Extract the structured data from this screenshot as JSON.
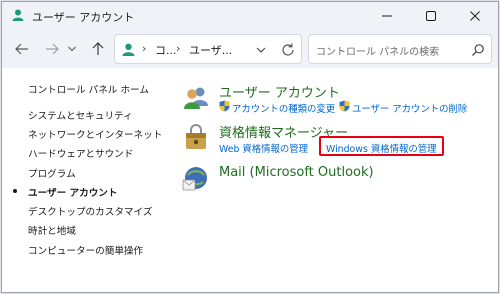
{
  "window": {
    "title": "ユーザー アカウント",
    "icon": "user-accounts-icon"
  },
  "navigation": {
    "address": {
      "segments": [
        "コ...",
        "ユーザ..."
      ]
    },
    "search": {
      "placeholder": "コントロール パネルの検索"
    }
  },
  "sidebar": {
    "items": [
      {
        "label": "コントロール パネル ホーム",
        "current": false
      },
      {
        "label": "システムとセキュリティ",
        "current": false
      },
      {
        "label": "ネットワークとインターネット",
        "current": false
      },
      {
        "label": "ハードウェアとサウンド",
        "current": false
      },
      {
        "label": "プログラム",
        "current": false
      },
      {
        "label": "ユーザー アカウント",
        "current": true
      },
      {
        "label": "デスクトップのカスタマイズ",
        "current": false
      },
      {
        "label": "時計と地域",
        "current": false
      },
      {
        "label": "コンピューターの簡単操作",
        "current": false
      }
    ]
  },
  "main": {
    "categories": [
      {
        "title": "ユーザー アカウント",
        "icon": "user-accounts-icon",
        "links": [
          "アカウントの種類の変更",
          "ユーザー アカウントの削除"
        ]
      },
      {
        "title": "資格情報マネージャー",
        "icon": "credential-manager-icon",
        "links": [
          "Web 資格情報の管理",
          "Windows 資格情報の管理"
        ]
      },
      {
        "title": "Mail (Microsoft Outlook)",
        "icon": "mail-icon",
        "links": []
      }
    ],
    "highlighted_link": "Windows 資格情報の管理"
  },
  "colors": {
    "category_title": "#1e6e1e",
    "link": "#0066cc",
    "highlight": "#e60012",
    "chrome": "#eff3f8"
  }
}
